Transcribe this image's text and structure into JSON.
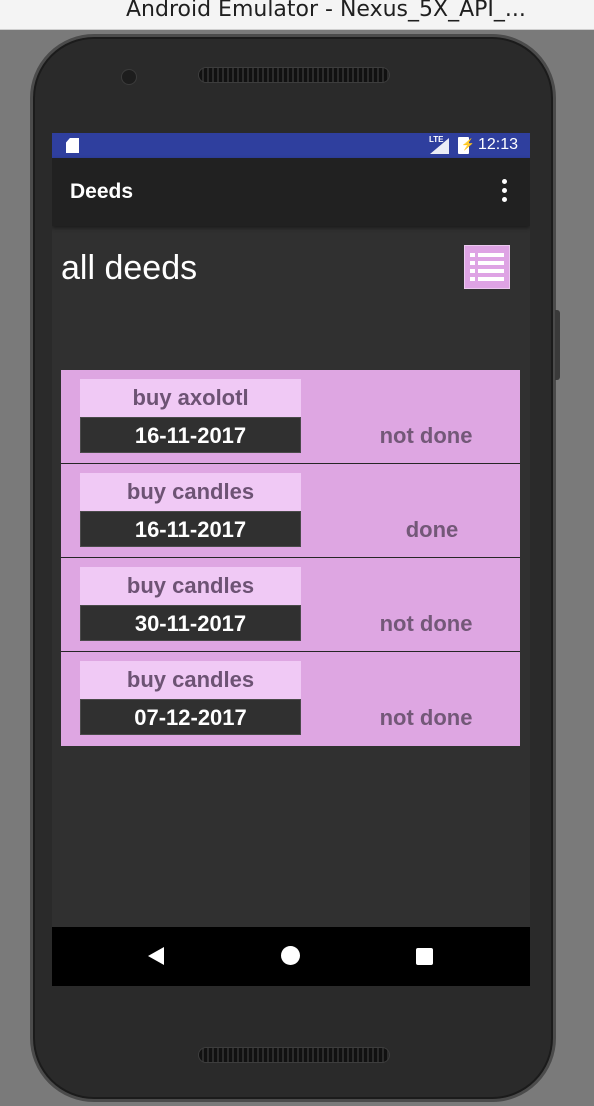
{
  "window": {
    "title": "Android Emulator - Nexus_5X_API_..."
  },
  "statusbar": {
    "network_label": "LTE",
    "time": "12:13",
    "color": "#2f3f9e"
  },
  "appbar": {
    "title": "Deeds",
    "overflow_icon": "more-vert-icon"
  },
  "main": {
    "title": "all deeds",
    "view_button_icon": "list-icon",
    "accent_color": "#dea6e2",
    "deeds": [
      {
        "name": "buy axolotl",
        "date": "16-11-2017",
        "status": "not done"
      },
      {
        "name": "buy candles",
        "date": "16-11-2017",
        "status": "done"
      },
      {
        "name": "buy candles",
        "date": "30-11-2017",
        "status": "not done"
      },
      {
        "name": "buy candles",
        "date": "07-12-2017",
        "status": "not done"
      }
    ]
  },
  "navbar": {
    "back_icon": "back-icon",
    "home_icon": "home-icon",
    "recents_icon": "recents-icon"
  }
}
